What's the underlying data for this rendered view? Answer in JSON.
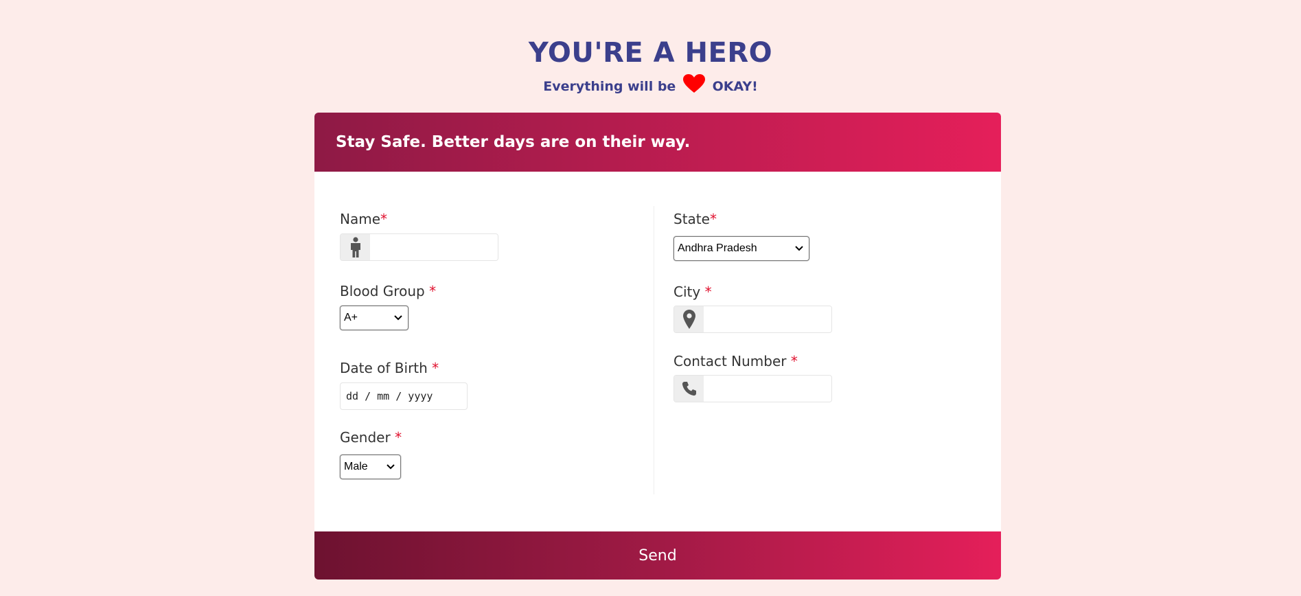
{
  "header": {
    "title": "YOU'RE A HERO",
    "subtitle_before": "Everything will be",
    "subtitle_after": "OKAY!",
    "heart_icon": "heart-icon",
    "heart_color": "#ff0000"
  },
  "card": {
    "banner": "Stay Safe. Better days are on their way.",
    "accent_start": "#8e1a45",
    "accent_end": "#e51f5a"
  },
  "form": {
    "name": {
      "label": "Name",
      "required": "*",
      "value": "",
      "icon": "person-icon"
    },
    "blood_group": {
      "label": "Blood Group ",
      "required": "*",
      "selected": "A+"
    },
    "dob": {
      "label": "Date of Birth ",
      "required": "*",
      "placeholder": "dd / mm / yyyy"
    },
    "gender": {
      "label": "Gender ",
      "required": "*",
      "selected": "Male"
    },
    "state": {
      "label": "State",
      "required": "*",
      "selected": "Andhra Pradesh"
    },
    "city": {
      "label": "City ",
      "required": "*",
      "value": "",
      "icon": "map-marker-icon"
    },
    "contact": {
      "label": "Contact Number ",
      "required": "*",
      "value": "",
      "icon": "phone-icon"
    }
  },
  "send_label": "Send"
}
